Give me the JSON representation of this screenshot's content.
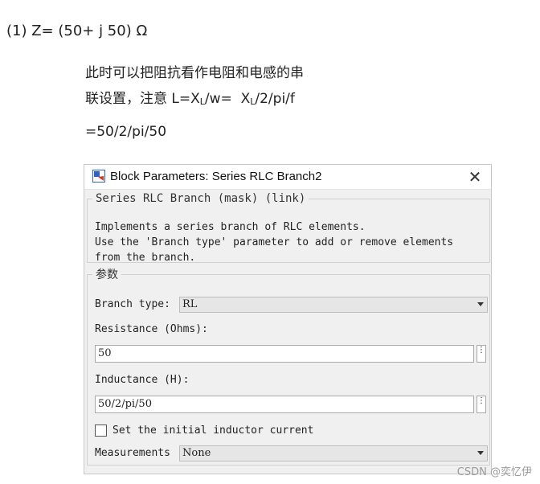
{
  "doc": {
    "line1": "(1) Z= (50+ j 50) Ω",
    "note_line1": "此时可以把阻抗看作电阻和电感的串",
    "note_line2_pre": "联设置，注意 L=X",
    "note_sub1": "L",
    "note_line2_mid": "/w=  X",
    "note_sub2": "L",
    "note_line2_post": "/2/pi/f",
    "note_line3": "=50/2/pi/50",
    "watermark": "CSDN @奕忆伊"
  },
  "dialog": {
    "title": "Block Parameters: Series RLC Branch2",
    "close_glyph": "✕",
    "mask_group_title": "Series RLC Branch (mask) (link)",
    "description": [
      "Implements a series branch of RLC elements.",
      "Use the 'Branch type' parameter to add or remove elements",
      "from the branch."
    ],
    "params_group_title": "参数",
    "branch_type_label": "Branch type:",
    "branch_type_value": "RL",
    "resistance_label": "Resistance (Ohms):",
    "resistance_value": "50",
    "inductance_label": "Inductance (H):",
    "inductance_value": "50/2/pi/50",
    "ellipsis_glyph": "⋮",
    "initial_current_label": "Set the initial inductor current",
    "initial_current_checked": false,
    "measurements_label": "Measurements",
    "measurements_value": "None"
  },
  "colors": {
    "dialog_bg": "#f0f0f0",
    "icon_blue": "#2b63c6",
    "icon_red": "#d9381e"
  }
}
